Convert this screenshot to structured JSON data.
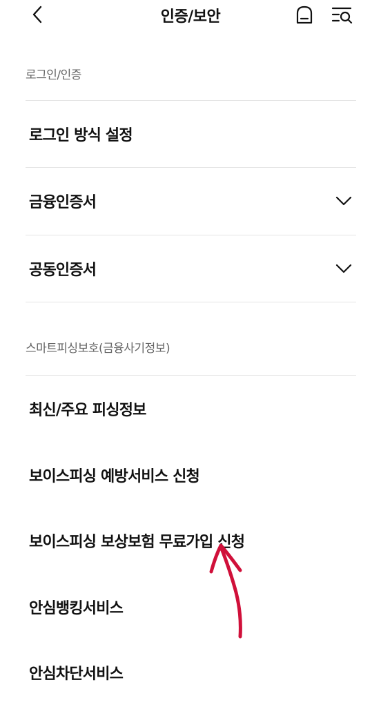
{
  "header": {
    "title": "인증/보안",
    "back_icon": "chevron-left-icon",
    "home_icon": "home-icon",
    "menu_search_icon": "menu-search-icon"
  },
  "sections": [
    {
      "label": "로그인/인증",
      "items": [
        {
          "label": "로그인 방식 설정",
          "expandable": false
        },
        {
          "label": "금융인증서",
          "expandable": true
        },
        {
          "label": "공동인증서",
          "expandable": true
        }
      ]
    },
    {
      "label": "스마트피싱보호(금융사기정보)",
      "items": [
        {
          "label": "최신/주요 피싱정보",
          "expandable": false
        },
        {
          "label": "보이스피싱 예방서비스 신청",
          "expandable": false
        },
        {
          "label": "보이스피싱 보상보험 무료가입 신청",
          "expandable": false
        },
        {
          "label": "안심뱅킹서비스",
          "expandable": false
        },
        {
          "label": "안심차단서비스",
          "expandable": false
        }
      ]
    }
  ],
  "colors": {
    "annotation_arrow": "#d0103a",
    "divider": "#e3e3e3",
    "section_label": "#666666"
  }
}
